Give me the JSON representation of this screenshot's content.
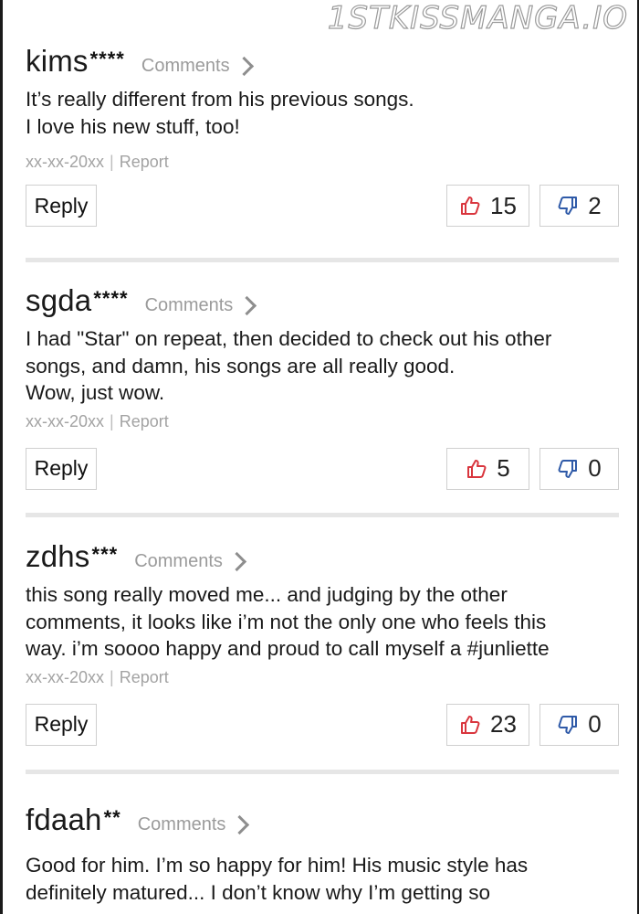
{
  "watermark": "1STKISSMANGA.IO",
  "comments_link_label": "Comments",
  "report_label": "Report",
  "reply_label": "Reply",
  "comments": [
    {
      "user": "kims",
      "stars": "****",
      "lines": [
        "It’s really different from his previous songs.",
        "I love his new stuff, too!"
      ],
      "date": "xx-xx-20xx",
      "likes": "15",
      "dislikes": "2"
    },
    {
      "user": "sgda",
      "stars": "****",
      "lines": [
        "I had \"Star\" on repeat, then decided to check out his other",
        "songs, and damn, his songs are all really good.",
        "Wow, just wow."
      ],
      "date": "xx-xx-20xx",
      "likes": "5",
      "dislikes": "0"
    },
    {
      "user": "zdhs",
      "stars": "***",
      "lines": [
        "this song really moved me... and judging by the other",
        "comments, it looks like i’m not the only one who feels this",
        "way. i’m soooo happy and proud to call myself a #junliette"
      ],
      "date": "xx-xx-20xx",
      "likes": "23",
      "dislikes": "0"
    },
    {
      "user": "fdaah",
      "stars": "**",
      "lines": [
        "Good for him. I’m so happy for him! His music style has",
        "definitely matured... I don’t know why I’m getting so"
      ]
    }
  ],
  "colors": {
    "like_icon": "#d9363e",
    "dislike_icon": "#2f5aa8",
    "divider": "#e6e6e6",
    "muted_text": "#9b9b9b"
  },
  "icons": {
    "like": "thumbs-up-icon",
    "dislike": "thumbs-down-icon",
    "chevron": "chevron-right-icon"
  }
}
